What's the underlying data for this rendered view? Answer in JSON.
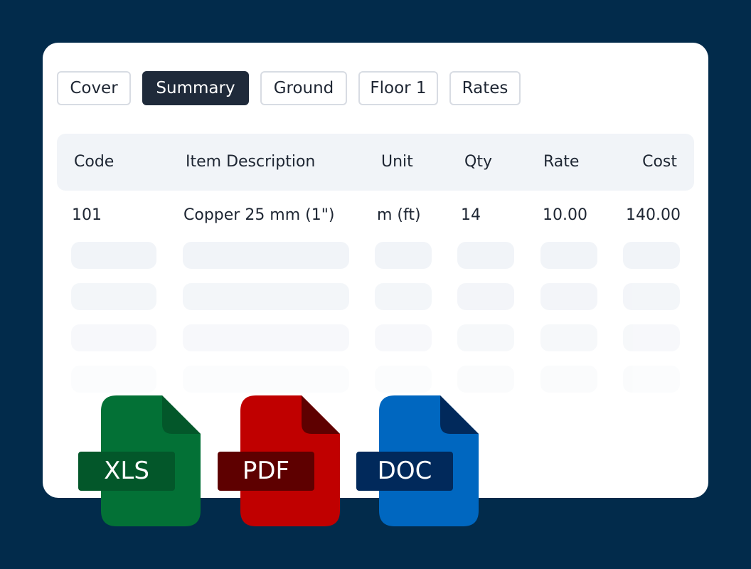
{
  "tabs": [
    {
      "label": "Cover",
      "active": false
    },
    {
      "label": "Summary",
      "active": true
    },
    {
      "label": "Ground",
      "active": false
    },
    {
      "label": "Floor  1",
      "active": false
    },
    {
      "label": "Rates",
      "active": false
    }
  ],
  "table": {
    "headers": [
      "Code",
      "Item Description",
      "Unit",
      "Qty",
      "Rate",
      "Cost"
    ],
    "rows": [
      [
        "101",
        "Copper 25 mm (1\")",
        "m (ft)",
        "14",
        "10.00",
        "140.00"
      ]
    ]
  },
  "files": [
    {
      "label": "XLS",
      "icon": "xls-file-icon",
      "color": "#037136",
      "fold_color": "#03572a",
      "label_bg": "#03572a"
    },
    {
      "label": "PDF",
      "icon": "pdf-file-icon",
      "color": "#c00000",
      "fold_color": "#5e0000",
      "label_bg": "#5e0000"
    },
    {
      "label": "DOC",
      "icon": "doc-file-icon",
      "color": "#0067c0",
      "fold_color": "#01295b",
      "label_bg": "#01295b"
    }
  ],
  "colors": {
    "background": "#022b4b",
    "card": "#ffffff",
    "active_tab": "#1f2a3a",
    "table_header": "#f1f4f8"
  }
}
